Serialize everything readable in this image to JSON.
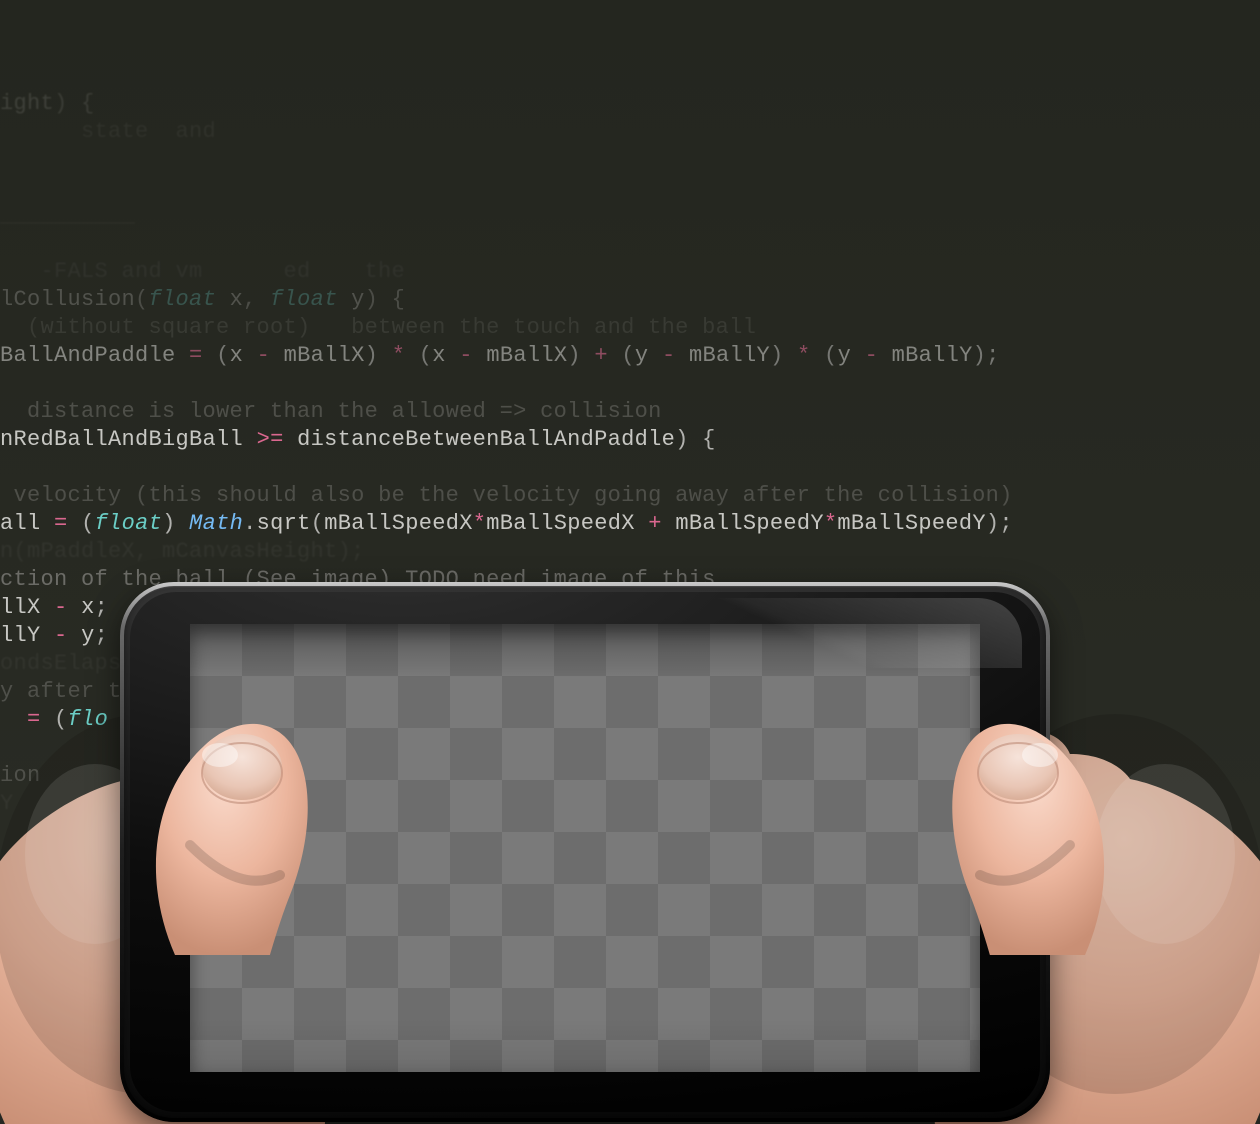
{
  "code_lines": [
    {
      "style": "tiny",
      "html": "                                                                      "
    },
    {
      "style": "tiny",
      "html": "<span class='id'>ight</span><span class='pn'>) {</span>"
    },
    {
      "style": "tiny",
      "html": "<span class='cm'>&nbsp;&nbsp;&nbsp;&nbsp;&nbsp;&nbsp;state  and&nbsp;&nbsp;&nbsp;</span>"
    },
    {
      "style": "tiny",
      "html": " "
    },
    {
      "style": "tiny",
      "html": " "
    },
    {
      "style": "tiny",
      "html": "<span class='cm'>__________</span>"
    },
    {
      "style": "tiny",
      "html": "<span class='cm'>                          </span>"
    },
    {
      "style": "tiny",
      "html": "<span class='cm'>   -FALS and vm      ed    the</span>"
    },
    {
      "style": "dim",
      "html": "<span class='id'>lCollusion</span><span class='pn'>(</span><span class='ty'>float</span> <span class='id'>x</span><span class='pn'>, </span><span class='ty'>float</span> <span class='id'>y</span><span class='pn'>) {</span>"
    },
    {
      "style": "dim",
      "html": "  <span class='cm'>(without square root)   between the touch and the ball</span>"
    },
    {
      "style": "mid",
      "html": "<span class='id'>BallAndPaddle</span> <span class='op'>=</span> <span class='pn'>(</span><span class='id'>x</span> <span class='op'>-</span> <span class='id'>mBallX</span><span class='pn'>)</span> <span class='op'>*</span> <span class='pn'>(</span><span class='id'>x</span> <span class='op'>-</span> <span class='id'>mBallX</span><span class='pn'>)</span> <span class='op'>+</span> <span class='pn'>(</span><span class='id'>y</span> <span class='op'>-</span> <span class='id'>mBallY</span><span class='pn'>)</span> <span class='op'>*</span> <span class='pn'>(</span><span class='id'>y</span> <span class='op'>-</span> <span class='id'>mBallY</span><span class='pn'>);</span>"
    },
    {
      "style": "mid",
      "html": " "
    },
    {
      "style": "mid",
      "html": "  <span class='cm'>distance is lower than the allowed =&gt; collision</span>"
    },
    {
      "style": "hi",
      "html": "<span class='id'>nRedBallAndBigBall</span> <span class='op'>&gt;=</span> <span class='id'>distanceBetweenBallAndPaddle</span><span class='pn'>) {</span>"
    },
    {
      "style": "hi",
      "html": " "
    },
    {
      "style": "mid",
      "html": " <span class='cm'>velocity (this should also be the velocity going away after the collision)</span>"
    },
    {
      "style": "hi",
      "html": "<span class='id'>all</span> <span class='op'>=</span> <span class='pn'>(</span><span class='ty'>float</span><span class='pn'>)</span> <span class='cl'>Math</span><span class='pn'>.</span><span class='fn'>sqrt</span><span class='pn'>(</span><span class='id'>mBallSpeedX</span><span class='op'>*</span><span class='id'>mBallSpeedX</span> <span class='op'>+</span> <span class='id'>mBallSpeedY</span><span class='op'>*</span><span class='id'>mBallSpeedY</span><span class='pn'>);</span>"
    },
    {
      "style": "tiny",
      "html": "<span class='cm'>n(mPaddleX, mCanvasHeight);</span>"
    },
    {
      "style": "hi",
      "html": "<span class='cm'>ction of the ball (See image) TODO need image of this</span>"
    },
    {
      "style": "hi",
      "html": "<span class='id'>llX</span> <span class='op'>-</span> <span class='id'>x</span><span class='pn'>;</span>"
    },
    {
      "style": "hi",
      "html": "<span class='id'>llY</span> <span class='op'>-</span> <span class='id'>y</span><span class='pn'>;</span>"
    },
    {
      "style": "tiny",
      "html": "<span class='cm'>ondsElaps</span>"
    },
    {
      "style": "mid",
      "html": "<span class='cm'>y after t</span>"
    },
    {
      "style": "hi",
      "html": "  <span class='op'>=</span> <span class='pn'>(</span><span class='ty'>flo</span>"
    },
    {
      "style": "mid",
      "html": " "
    },
    {
      "style": "mid",
      "html": "<span class='cm'>ion</span>"
    },
    {
      "style": "tiny",
      "html": "<span class='cm'>Y</span>"
    }
  ],
  "device": {
    "screen_pattern": "transparency-checker",
    "checker_colors": [
      "#6d6d6d",
      "#7a7a7a"
    ]
  }
}
